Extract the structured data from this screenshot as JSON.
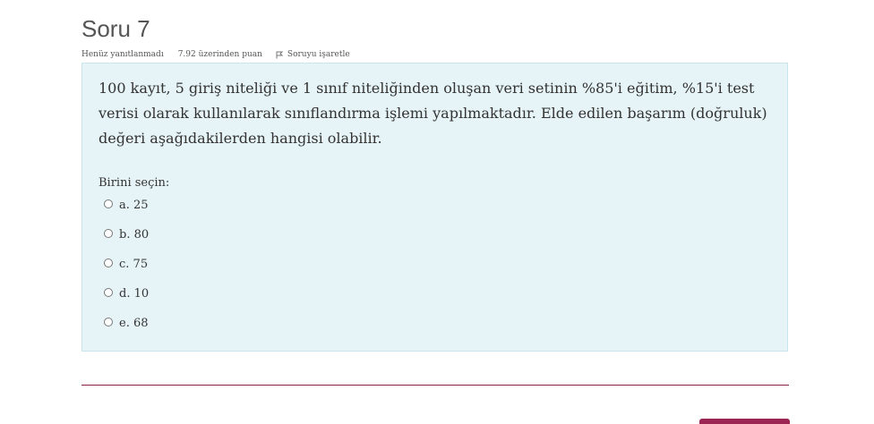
{
  "question": {
    "title": "Soru 7",
    "status": "Henüz yanıtlanmadı",
    "grade": "7.92 üzerinden puan",
    "flag_label": "Soruyu işaretle",
    "text": "100 kayıt, 5 giriş niteliği ve 1 sınıf niteliğinden oluşan veri setinin %85'i eğitim, %15'i test verisi olarak kullanılarak sınıflandırma işlemi yapılmaktadır. Elde edilen başarım (doğruluk) değeri aşağıdakilerden hangisi olabilir.",
    "prompt": "Birini seçin:",
    "options": [
      {
        "label": "a. 25"
      },
      {
        "label": "b. 80"
      },
      {
        "label": "c. 75"
      },
      {
        "label": "d. 10"
      },
      {
        "label": "e. 68"
      }
    ]
  },
  "colors": {
    "question_box_bg": "#e6f4f7",
    "question_box_border": "#c7e6ee",
    "accent": "#9b2553",
    "divider": "#8a1f46"
  },
  "icons": {
    "flag": "flag-icon",
    "radio": "radio-unchecked-icon"
  }
}
